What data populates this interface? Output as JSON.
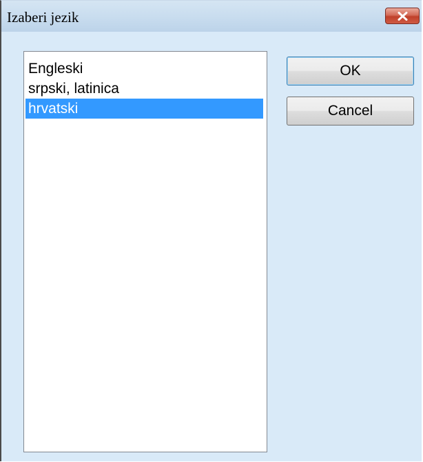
{
  "window": {
    "title": "Izaberi jezik"
  },
  "language_list": {
    "items": [
      {
        "label": "Engleski",
        "selected": false
      },
      {
        "label": "srpski, latinica",
        "selected": false
      },
      {
        "label": "hrvatski",
        "selected": true
      }
    ]
  },
  "buttons": {
    "ok_label": "OK",
    "cancel_label": "Cancel"
  },
  "colors": {
    "dialog_background": "#d9eaf8",
    "selection_highlight": "#3399ff",
    "close_button": "#c0412b"
  },
  "icons": {
    "close": "close-icon"
  }
}
